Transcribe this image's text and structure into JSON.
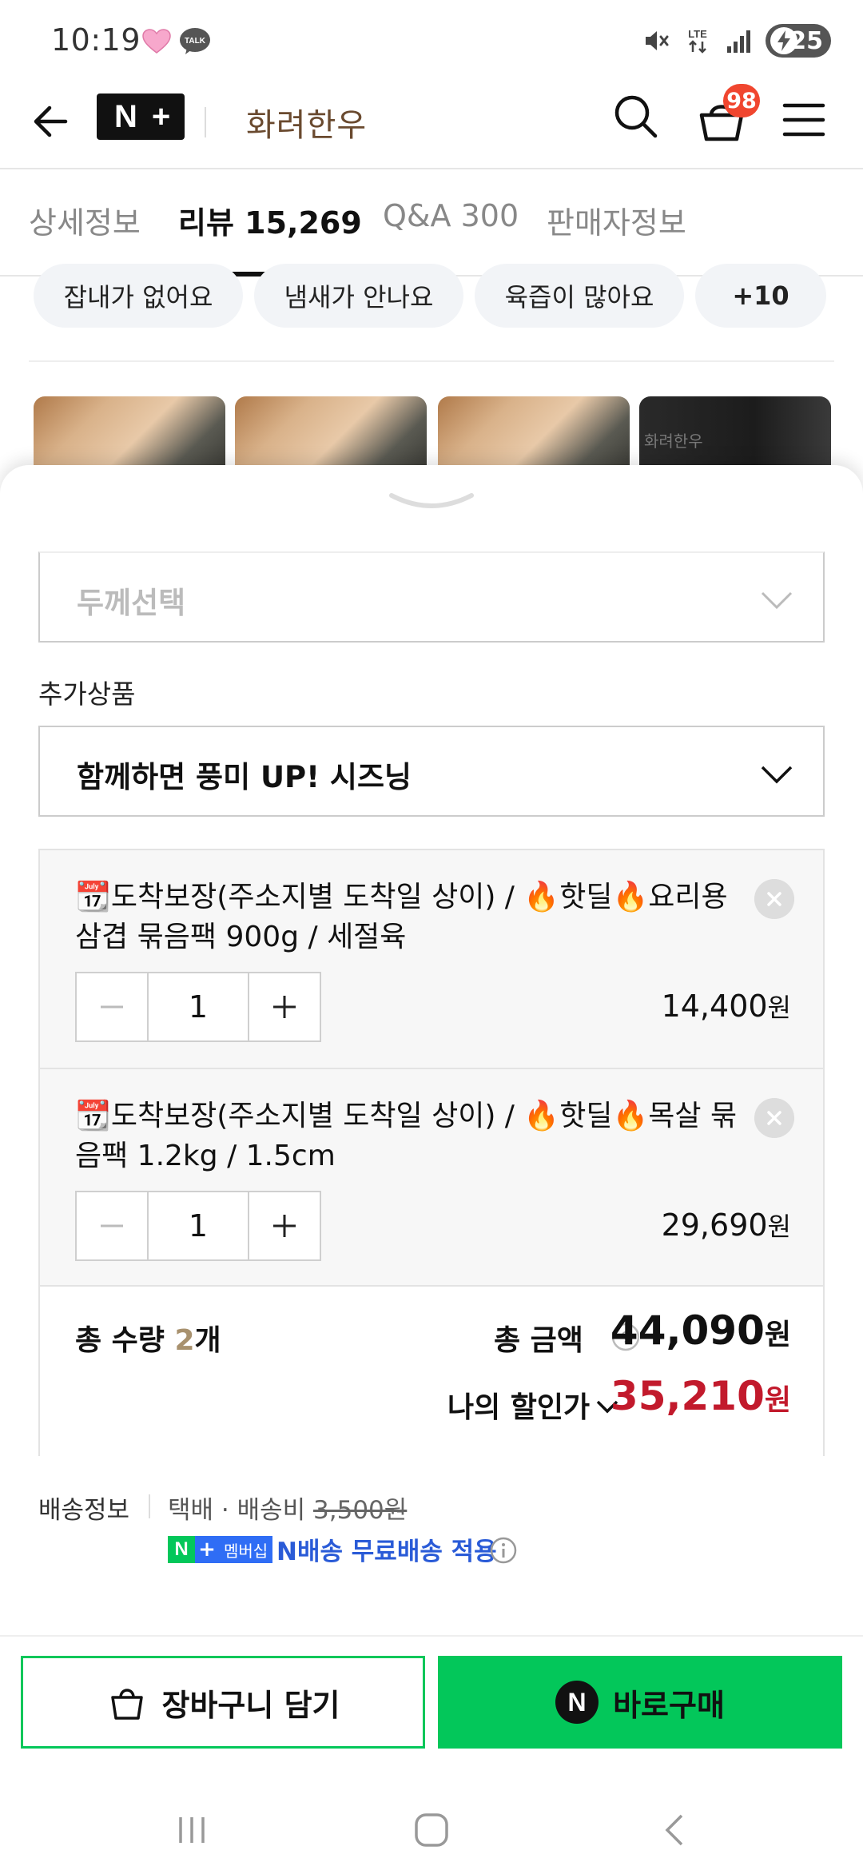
{
  "status": {
    "time": "10:19",
    "network": "LTE",
    "battery": "25"
  },
  "header": {
    "brand_logo": "N+",
    "brand_name": "화려한우",
    "cart_count": "98"
  },
  "tabs": [
    {
      "label": "상세정보",
      "active": false
    },
    {
      "label": "리뷰 15,269",
      "active": true
    },
    {
      "label": "Q&A 300",
      "active": false
    },
    {
      "label": "판매자정보",
      "active": false
    }
  ],
  "review_keywords": [
    "잡내가 없어요",
    "냄새가 안나요",
    "육즙이 많아요",
    "+10"
  ],
  "thumbnail_caption": "화려한우",
  "sheet": {
    "thickness_select": {
      "placeholder": "두께선택"
    },
    "addon_label": "추가상품",
    "addon_select": {
      "value": "함께하면 풍미 UP! 시즈닝"
    },
    "options": [
      {
        "name": "📆도착보장(주소지별 도착일 상이) / 🔥핫딜🔥요리용삼겹 묶음팩 900g / 세절육",
        "qty": "1",
        "price": "14,400",
        "currency": "원"
      },
      {
        "name": "📆도착보장(주소지별 도착일 상이) / 🔥핫딜🔥목살 묶음팩 1.2kg / 1.5cm",
        "qty": "1",
        "price": "29,690",
        "currency": "원"
      }
    ],
    "totals": {
      "qty_prefix": "총 수량 ",
      "qty_value": "2",
      "qty_suffix": "개",
      "amount_label": "총 금액",
      "amount": "44,090",
      "discount_label": "나의 할인가",
      "discount_amount": "35,210",
      "currency": "원"
    },
    "shipping": {
      "label": "배송정보",
      "method": "택배 · 배송비 ",
      "fee": "3,500원",
      "membership_badge_n": "N",
      "membership_badge_plus": "+",
      "membership_badge_text": "멤버십",
      "free_shipping": "N배송 무료배송 적용"
    },
    "cta": {
      "cart": "장바구니 담기",
      "buy_icon": "N",
      "buy": "바로구매"
    }
  },
  "colors": {
    "naver_green": "#03c75a",
    "discount_red": "#c21a2c",
    "badge_red": "#f0462f",
    "brand_brown": "#6a4a2f"
  }
}
